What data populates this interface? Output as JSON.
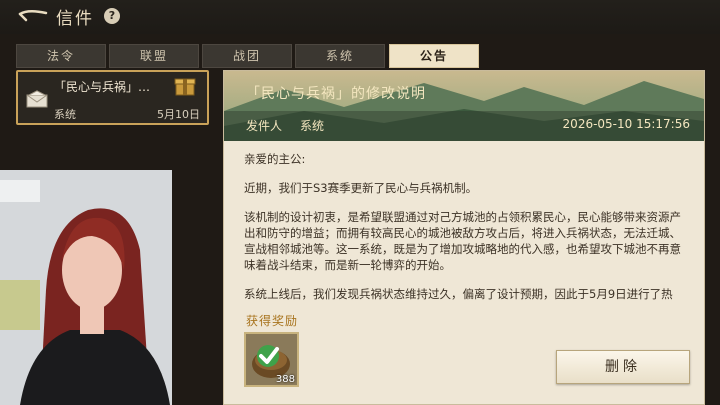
{
  "header": {
    "title": "信件",
    "help": "?"
  },
  "tabs": [
    "法令",
    "联盟",
    "战团",
    "系统",
    "公告"
  ],
  "active_tab": "公告",
  "mail_list": [
    {
      "title": "「民心与兵祸」…",
      "sender": "系统",
      "date": "5月10日"
    }
  ],
  "mail": {
    "title": "「民心与兵祸」的修改说明",
    "sender_label": "发件人",
    "sender": "系统",
    "time": "2026-05-10 15:17:56",
    "paragraphs": [
      "亲爱的主公:",
      "近期，我们于S3赛季更新了民心与兵祸机制。",
      "该机制的设计初衷，是希望联盟通过对己方城池的占领积累民心，民心能够带来资源产出和防守的增益；而拥有较高民心的城池被敌方攻占后，将进入兵祸状态，无法迁城、宣战相邻城池等。这一系统，既是为了增加攻城略地的代入感，也希望攻下城池不再意味着战斗结束，而是新一轮博弈的开始。",
      "系统上线后，我们发现兵祸状态维持过久，偏离了设计预期，因此于5月9日进行了热"
    ],
    "reward_label": "获得奖励",
    "reward_count": "388",
    "delete_label": "删除"
  },
  "colors": {
    "accent_gold": "#c9a259",
    "reward_label": "#a8741e",
    "panel_bg": "#efe7d6",
    "active_tab_bg": "#efe3c7"
  }
}
